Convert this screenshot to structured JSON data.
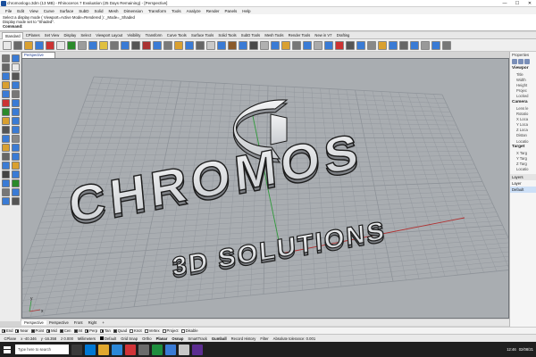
{
  "window": {
    "title": "chromoslogo.3dm (13 MB) - Rhinoceros 7 Evaluation (25 Days Remaining) - [Perspective]",
    "controls": [
      "—",
      "☐",
      "✕"
    ]
  },
  "menu": [
    "File",
    "Edit",
    "View",
    "Curve",
    "Surface",
    "SubD",
    "Solid",
    "Mesh",
    "Dimension",
    "Transform",
    "Tools",
    "Analyze",
    "Render",
    "Panels",
    "Help"
  ],
  "command": {
    "history": [
      "Select a display mode ( Viewport=Active  Mode=Rendered ): _Mode=_Shaded",
      "Display mode set to \"Shaded\"."
    ],
    "prompt": "Command:"
  },
  "tabs": {
    "items": [
      "Standard",
      "CPlanes",
      "Set View",
      "Display",
      "Select",
      "Viewport Layout",
      "Visibility",
      "Transform",
      "Curve Tools",
      "Surface Tools",
      "Solid Tools",
      "SubD Tools",
      "Mesh Tools",
      "Render Tools",
      "New in V7",
      "Drafting"
    ],
    "active_index": 0
  },
  "toolbar_icon_colors": [
    "#e8e8e8",
    "#6a6a6a",
    "#d9a030",
    "#3a7bd5",
    "#c33",
    "#e8e8e8",
    "#2a8a2a",
    "#9c9c9c",
    "#3a7bd5",
    "#e0c040",
    "#777",
    "#3a7bd5",
    "#555",
    "#a33",
    "#3a7bd5",
    "#7a7a7a",
    "#d9a030",
    "#3a7bd5",
    "#666",
    "#c8c8c8",
    "#3a7bd5",
    "#8a5a2a",
    "#3a7bd5",
    "#4a4a4a",
    "#b0b0b0",
    "#3a7bd5",
    "#d9a030",
    "#777",
    "#3a7bd5",
    "#aaa",
    "#3a7bd5",
    "#c33",
    "#555",
    "#3a7bd5",
    "#888",
    "#d9a030",
    "#3a7bd5",
    "#666",
    "#3a7bd5",
    "#999",
    "#3a7bd5",
    "#777"
  ],
  "left_tool_colors": [
    "#777",
    "#3a7bd5",
    "#666",
    "#e8e8e8",
    "#3a7bd5",
    "#555",
    "#d9a030",
    "#3a7bd5",
    "#3a7bd5",
    "#777",
    "#c33",
    "#3a7bd5",
    "#2a8a2a",
    "#3a7bd5",
    "#d9a030",
    "#3a7bd5",
    "#555",
    "#3a7bd5",
    "#3a7bd5",
    "#888",
    "#d9a030",
    "#3a7bd5",
    "#666",
    "#3a7bd5",
    "#3a7bd5",
    "#d9a030",
    "#444",
    "#3a7bd5",
    "#3a7bd5",
    "#2a8a2a",
    "#777",
    "#3a7bd5",
    "#3a7bd5",
    "#555"
  ],
  "viewport": {
    "active_label": "Perspective",
    "logo": {
      "line1": "CHROMOS",
      "line2": "3D SOLUTIONS"
    },
    "colors": {
      "bg": "#a9adb1",
      "grid": "#8e9399",
      "x_axis": "#b03030",
      "y_axis": "#2f9a3a",
      "letter_fill": "#e3e5e7",
      "letter_edge": "#1c1c1c"
    },
    "axis_widget": {
      "x": "x",
      "y": "y"
    }
  },
  "viewport_tabs": {
    "items": [
      "Perspective",
      "Perspective",
      "Front",
      "Right",
      "+"
    ],
    "active_index": 0
  },
  "osnaps": [
    {
      "label": "End",
      "on": true
    },
    {
      "label": "Near",
      "on": true
    },
    {
      "label": "Point",
      "on": true
    },
    {
      "label": "Mid",
      "on": true
    },
    {
      "label": "Cen",
      "on": true
    },
    {
      "label": "Int",
      "on": true
    },
    {
      "label": "Perp",
      "on": true
    },
    {
      "label": "Tan",
      "on": true
    },
    {
      "label": "Quad",
      "on": true
    },
    {
      "label": "Knot",
      "on": false
    },
    {
      "label": "Vertex",
      "on": false
    },
    {
      "label": "Project",
      "on": false
    },
    {
      "label": "Disable",
      "on": false
    }
  ],
  "status": {
    "cplane": "CPlane",
    "x": "x -40.346",
    "y": "y -16.358",
    "z": "z 0.000",
    "units": "Millimeters",
    "layer": "Default",
    "toggles": [
      "Grid Snap",
      "Ortho",
      "Planar",
      "Osnap",
      "SmartTrack",
      "Gumball",
      "Record History",
      "Filter"
    ],
    "bold_toggles": [
      "Planar",
      "Osnap",
      "Gumball"
    ],
    "tolerance": "Absolute tolerance: 0.001"
  },
  "right_panel": {
    "tab": "Properties",
    "viewport_header": "Viewpor",
    "viewport_rows": [
      "Title",
      "Width",
      "Height",
      "Projec",
      "Locked"
    ],
    "camera_header": "Camera",
    "camera_rows": [
      "Lens le",
      "Rotatio",
      "X Loca",
      "Y Loca",
      "Z Loca",
      "Distan",
      "Locatio"
    ],
    "target_header": "Target",
    "target_rows": [
      "X Targ",
      "Y Targ",
      "Z Targ",
      "Locatio"
    ],
    "layers_tab": "Layers",
    "layers_column": "Layer",
    "layers": [
      "Default"
    ]
  },
  "taskbar": {
    "search_placeholder": "Type here to search",
    "app_colors": [
      "#3a3a3a",
      "#0078d4",
      "#e0a82e",
      "#2b88d8",
      "#d13438",
      "#6b6b6b",
      "#1e8f3e",
      "#3a7bd5",
      "#c8c8c8",
      "#5c2d91"
    ],
    "time": "12:46",
    "date": "02/08/21"
  }
}
